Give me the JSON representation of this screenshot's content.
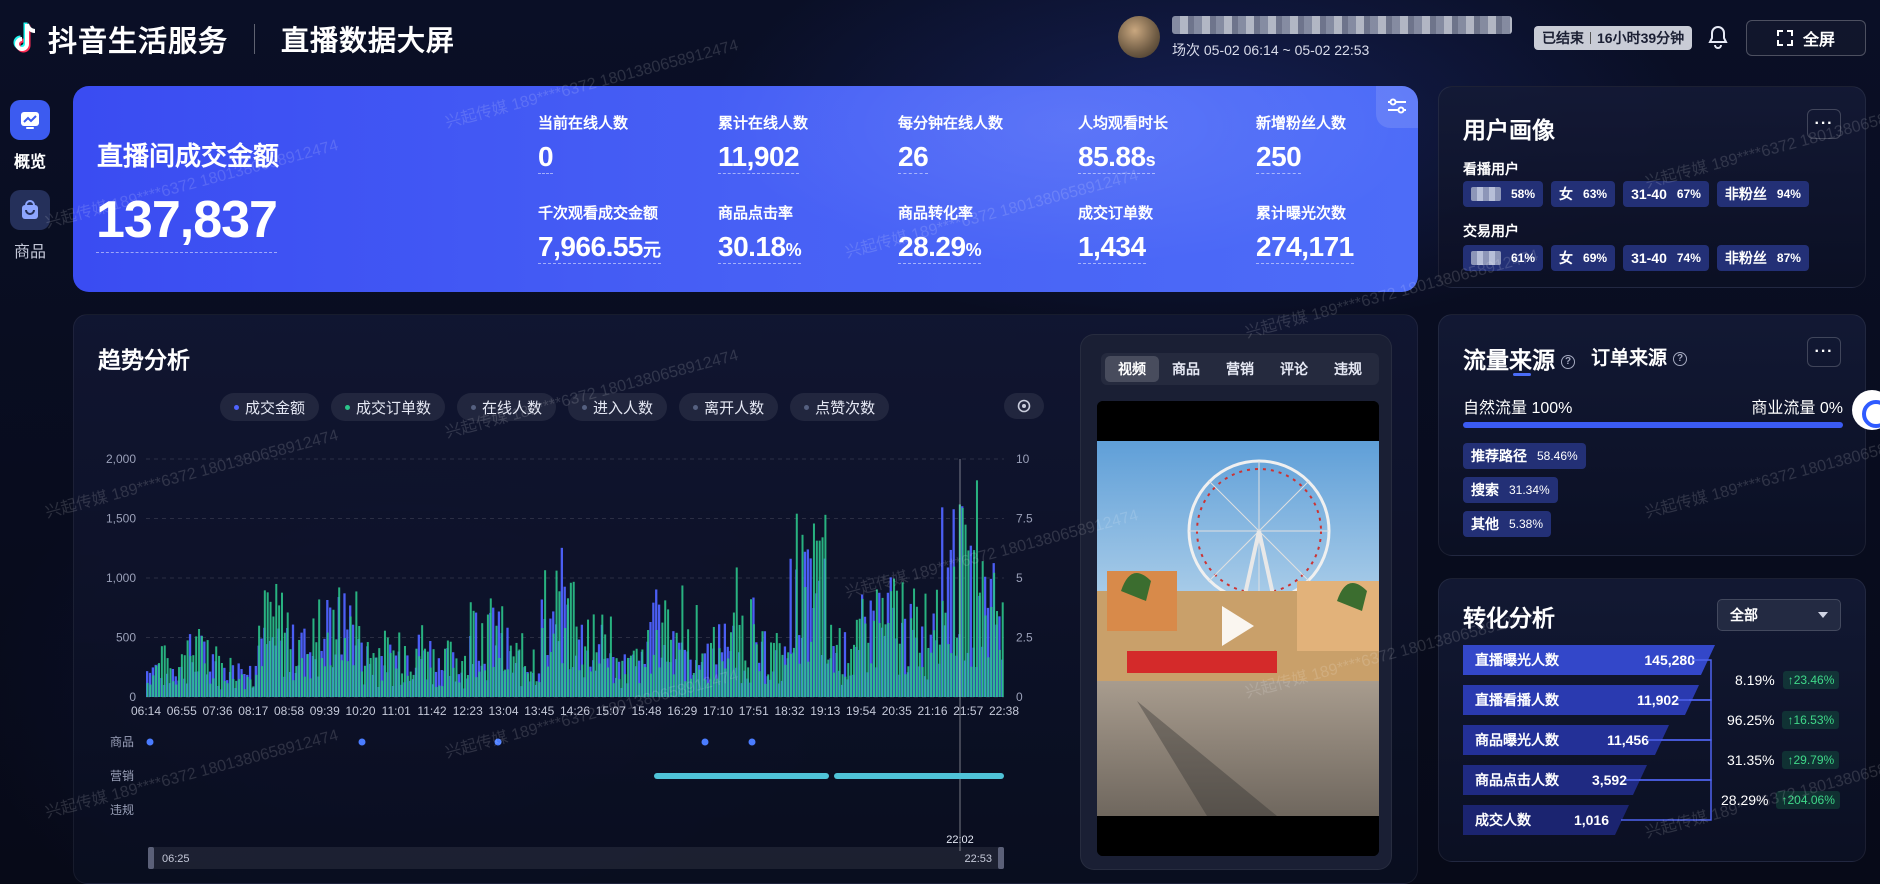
{
  "header": {
    "brand": "抖音生活服务",
    "screen_title": "直播数据大屏",
    "session": "场次 05-02 06:14 ~ 05-02 22:53",
    "status": "已结束",
    "duration": "16小时39分钟",
    "fullscreen": "全屏"
  },
  "nav": {
    "items": [
      {
        "label": "概览"
      },
      {
        "label": "商品"
      }
    ]
  },
  "hero": {
    "main_label": "直播间成交金额",
    "main_value": "137,837",
    "metrics": [
      {
        "label": "当前在线人数",
        "value": "0",
        "unit": ""
      },
      {
        "label": "累计在线人数",
        "value": "11,902",
        "unit": ""
      },
      {
        "label": "每分钟在线人数",
        "value": "26",
        "unit": ""
      },
      {
        "label": "人均观看时长",
        "value": "85.88",
        "unit": "s"
      },
      {
        "label": "新增粉丝人数",
        "value": "250",
        "unit": ""
      },
      {
        "label": "千次观看成交金额",
        "value": "7,966.55",
        "unit": "元"
      },
      {
        "label": "商品点击率",
        "value": "30.18",
        "unit": "%"
      },
      {
        "label": "商品转化率",
        "value": "28.29",
        "unit": "%"
      },
      {
        "label": "成交订单数",
        "value": "1,434",
        "unit": ""
      },
      {
        "label": "累计曝光次数",
        "value": "274,171",
        "unit": ""
      }
    ]
  },
  "trend": {
    "title": "趋势分析",
    "legend": [
      {
        "label": "成交金额",
        "color": "#4f63ff"
      },
      {
        "label": "成交订单数",
        "color": "#2bc48a"
      },
      {
        "label": "在线人数",
        "color": "#556080"
      },
      {
        "label": "进入人数",
        "color": "#556080"
      },
      {
        "label": "离开人数",
        "color": "#556080"
      },
      {
        "label": "点赞次数",
        "color": "#556080"
      }
    ],
    "event_rows": [
      "商品",
      "营销",
      "违规"
    ],
    "range_start": "06:25",
    "range_end": "22:53",
    "cursor_time": "22:02"
  },
  "chart_data": {
    "type": "bar",
    "x_ticks": [
      "06:14",
      "06:55",
      "07:36",
      "08:17",
      "08:58",
      "09:39",
      "10:20",
      "11:01",
      "11:42",
      "12:23",
      "13:04",
      "13:45",
      "14:26",
      "15:07",
      "15:48",
      "16:29",
      "17:10",
      "17:51",
      "18:32",
      "19:13",
      "19:54",
      "20:35",
      "21:16",
      "21:57",
      "22:38"
    ],
    "y_left_ticks": [
      "0",
      "500",
      "1,000",
      "1,500",
      "2,000"
    ],
    "y_right_ticks": [
      "0",
      "2.5",
      "5",
      "7.5",
      "10"
    ],
    "ylim_left": [
      0,
      2000
    ],
    "ylim_right": [
      0,
      10
    ],
    "series": [
      {
        "name": "成交金额",
        "color": "#4f63ff",
        "axis": "left",
        "peaks": [
          420,
          610,
          380,
          900,
          700,
          1000,
          560,
          640,
          470,
          820,
          500,
          1050,
          690,
          450,
          900,
          580,
          760,
          520,
          1400,
          620,
          1000,
          880,
          1800,
          1450
        ]
      },
      {
        "name": "成交订单数",
        "color": "#2bc48a",
        "axis": "right",
        "peaks": [
          2.5,
          3.6,
          2.1,
          5.4,
          4.0,
          6.2,
          3.2,
          4.1,
          2.8,
          5.1,
          3.0,
          6.4,
          4.5,
          2.6,
          5.6,
          3.4,
          4.7,
          3.2,
          9.0,
          3.7,
          6.1,
          5.4,
          9.5,
          8.4
        ]
      }
    ],
    "grid": true
  },
  "video": {
    "tabs": [
      "视频",
      "商品",
      "营销",
      "评论",
      "违规"
    ],
    "active_tab": "视频"
  },
  "profile": {
    "title": "用户画像",
    "more": "···",
    "groups": [
      {
        "label": "看播用户",
        "tags": [
          {
            "name": "",
            "pct": "58%"
          },
          {
            "name": "女",
            "pct": "63%"
          },
          {
            "name": "31-40",
            "pct": "67%"
          },
          {
            "name": "非粉丝",
            "pct": "94%"
          }
        ]
      },
      {
        "label": "交易用户",
        "tags": [
          {
            "name": "",
            "pct": "61%"
          },
          {
            "name": "女",
            "pct": "69%"
          },
          {
            "name": "31-40",
            "pct": "74%"
          },
          {
            "name": "非粉丝",
            "pct": "87%"
          }
        ]
      }
    ]
  },
  "traffic": {
    "tab_traffic": "流量来源",
    "tab_order": "订单来源",
    "more": "···",
    "natural_label": "自然流量 100%",
    "commercial_label": "商业流量 0%",
    "natural_share": 100,
    "paths": [
      {
        "name": "推荐路径",
        "pct": "58.46%"
      },
      {
        "name": "搜索",
        "pct": "31.34%"
      },
      {
        "name": "其他",
        "pct": "5.38%"
      }
    ]
  },
  "conversion": {
    "title": "转化分析",
    "select": "全部",
    "funnel": [
      {
        "name": "直播曝光人数",
        "value": "145,280",
        "color": "#3347c9"
      },
      {
        "name": "直播看播人数",
        "value": "11,902",
        "color": "#2a3ab0"
      },
      {
        "name": "商品曝光人数",
        "value": "11,456",
        "color": "#233097"
      },
      {
        "name": "商品点击人数",
        "value": "3,592",
        "color": "#1f2a82"
      },
      {
        "name": "成交人数",
        "value": "1,016",
        "color": "#1b2470"
      }
    ],
    "rates": [
      {
        "rate": "8.19%",
        "change": "↑23.46%"
      },
      {
        "rate": "96.25%",
        "change": "↑16.53%"
      },
      {
        "rate": "31.35%",
        "change": "↑29.79%"
      },
      {
        "rate": "28.29%",
        "change": "↑204.06%"
      }
    ]
  },
  "watermark": "兴起传媒 189****6372 18013806589124​74"
}
